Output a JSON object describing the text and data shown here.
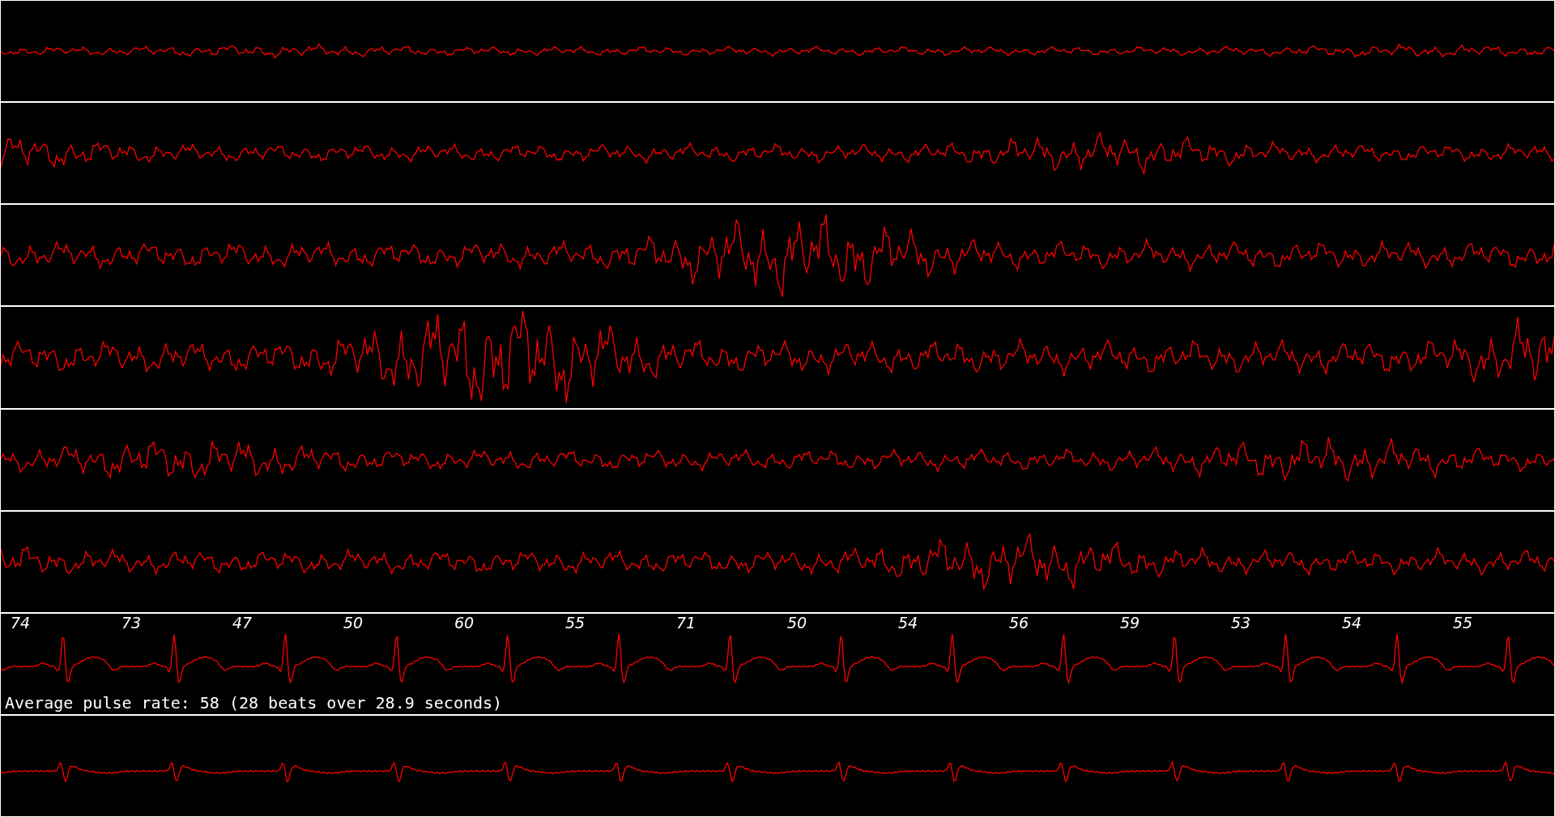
{
  "traces": [
    {
      "kind": "noise"
    },
    {
      "kind": "noise"
    },
    {
      "kind": "noise"
    },
    {
      "kind": "noise"
    },
    {
      "kind": "noise"
    },
    {
      "kind": "noise"
    },
    {
      "kind": "ecg",
      "beat_labels": [
        "74",
        "73",
        "47",
        "50",
        "60",
        "55",
        "71",
        "50",
        "54",
        "56",
        "59",
        "53",
        "54",
        "55"
      ],
      "caption": "Average pulse rate: 58 (28 beats over 28.9 seconds)"
    },
    {
      "kind": "ecg_small"
    }
  ]
}
